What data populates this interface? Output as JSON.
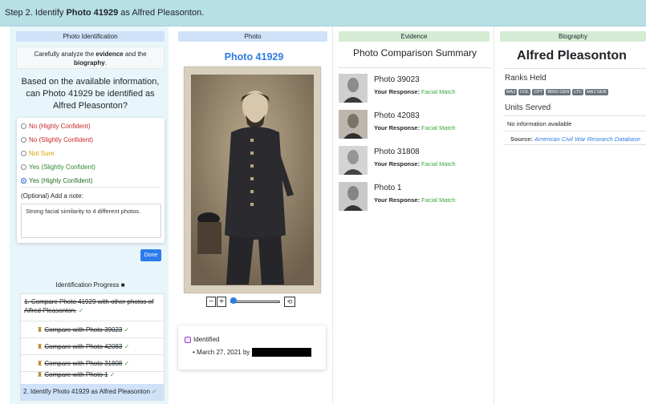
{
  "step": {
    "prefix": "Step 2. Identify ",
    "photo": "Photo 41929",
    "suffix": " as Alfred Pleasonton."
  },
  "identification": {
    "header": "Photo Identification",
    "instr_pre": "Carefully analyze the ",
    "instr_evidence": "evidence",
    "instr_mid": " and the ",
    "instr_bio": "biography",
    "instr_end": ".",
    "question": "Based on the available information, can Photo 41929 be identified as Alfred Pleasonton?",
    "options": [
      {
        "label": "No (Highly Confident)",
        "color": "#c62828",
        "selected": false
      },
      {
        "label": "No (Slightly Confident)",
        "color": "#c62828",
        "selected": false
      },
      {
        "label": "Not Sure",
        "color": "#e0a100",
        "selected": false
      },
      {
        "label": "Yes (Slightly Confident)",
        "color": "#2e8b2e",
        "selected": false
      },
      {
        "label": "Yes (Highly Confident)",
        "color": "#1e6b1e",
        "selected": true
      }
    ],
    "note_label": "(Optional) Add a note:",
    "note_value": "Strong facial similarity to 4 different photos.",
    "done_label": "Done"
  },
  "progress": {
    "title": "Identification Progress",
    "main": "1. Compare Photo 41929 with other photos of Alfred Pleasonton.",
    "subs": [
      "Compare with Photo 39023",
      "Compare with Photo 42083",
      "Compare with Photo 31808",
      "Compare with Photo 1"
    ],
    "current": "2. Identify Photo 41929 as Alfred Pleasonton",
    "check": "✓",
    "trophy": "♜"
  },
  "photo": {
    "header": "Photo",
    "title": "Photo 41929",
    "zoom_out": "−",
    "zoom_in": "+",
    "reset": "⟲",
    "zoom_level": 0.05,
    "identified_label": "Identified",
    "identified_date": "March 27, 2021 by"
  },
  "evidence": {
    "header": "Evidence",
    "title": "Photo Comparison Summary",
    "response_label": "Your Response:",
    "items": [
      {
        "name": "Photo 39023",
        "response": "Facial Match"
      },
      {
        "name": "Photo 42083",
        "response": "Facial Match"
      },
      {
        "name": "Photo 31808",
        "response": "Facial Match"
      },
      {
        "name": "Photo 1",
        "response": "Facial Match"
      }
    ]
  },
  "biography": {
    "header": "Biography",
    "name": "Alfred Pleasonton",
    "ranks_label": "Ranks Held",
    "ranks": [
      "MAJ",
      "COL",
      "CPT",
      "BRIG GEN",
      "LTC",
      "MAJ GEN"
    ],
    "units_label": "Units Served",
    "units_value": "No information available",
    "source_label": "Source:",
    "source_value": "American Civil War Research Database"
  }
}
